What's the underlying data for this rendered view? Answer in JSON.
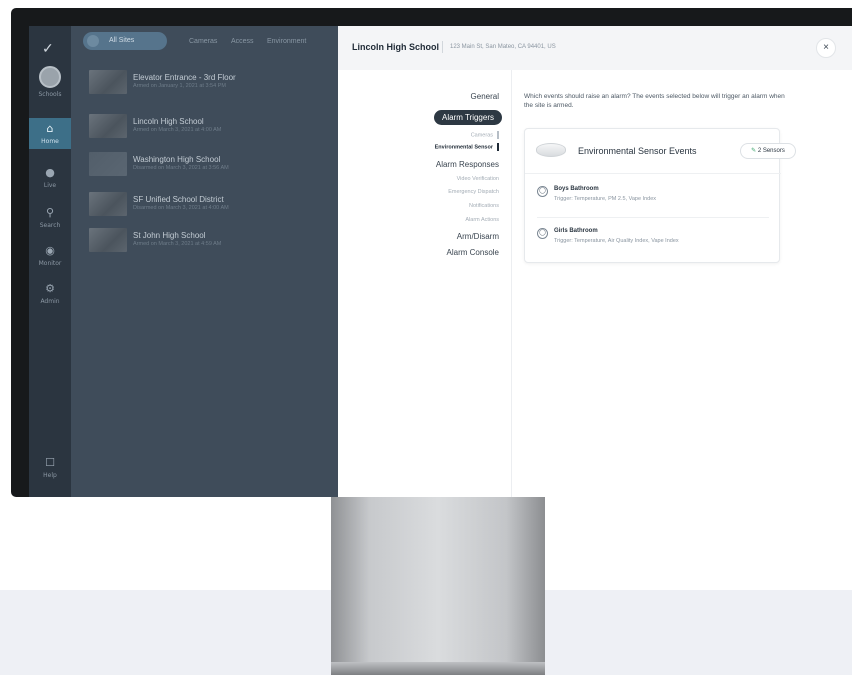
{
  "nav": {
    "items": [
      {
        "label": "Schools",
        "icon": "avatar"
      },
      {
        "label": "Home",
        "icon": "home-icon"
      },
      {
        "label": "Live",
        "icon": "pin-icon"
      },
      {
        "label": "Search",
        "icon": "search-icon"
      },
      {
        "label": "Monitor",
        "icon": "eye-icon"
      },
      {
        "label": "Admin",
        "icon": "gear-icon"
      },
      {
        "label": "Help",
        "icon": "chat-icon"
      }
    ]
  },
  "list": {
    "tabs": [
      "All Sites",
      "Cameras",
      "Access",
      "Environment"
    ],
    "items": [
      {
        "title": "Elevator Entrance - 3rd Floor",
        "sub": "Armed on January 1, 2021 at 3:54 PM"
      },
      {
        "title": "Lincoln High School",
        "sub": "Armed on March 3, 2021 at 4:00 AM"
      },
      {
        "title": "Washington High School",
        "sub": "Disarmed on March 3, 2021 at 3:56 AM"
      },
      {
        "title": "SF Unified School District",
        "sub": "Disarmed on March 3, 2021 at 4:00 AM"
      },
      {
        "title": "St John High School",
        "sub": "Armed on March 3, 2021 at 4:59 AM"
      }
    ]
  },
  "drawer": {
    "title": "Lincoln High School",
    "address": "123 Main St, San Mateo, CA 94401, US",
    "close": "×",
    "subnav": {
      "general": "General",
      "alarm_triggers": "Alarm Triggers",
      "cameras": "Cameras",
      "environmental_sensor": "Environmental Sensor",
      "alarm_responses": "Alarm Responses",
      "video_verification": "Video Verification",
      "emergency_dispatch": "Emergency Dispatch",
      "notifications": "Notifications",
      "alarm_actions": "Alarm Actions",
      "arm_disarm": "Arm/Disarm",
      "alarm_console": "Alarm Console"
    },
    "intro": "Which events should raise an alarm? The events selected below will trigger an alarm when the site is armed.",
    "card": {
      "title": "Environmental Sensor Events",
      "sensors_button": "2 Sensors",
      "events": [
        {
          "title": "Boys Bathroom",
          "sub": "Trigger: Temperature, PM 2.5, Vape Index"
        },
        {
          "title": "Girls Bathroom",
          "sub": "Trigger: Temperature, Air Quality Index, Vape Index"
        }
      ]
    }
  }
}
